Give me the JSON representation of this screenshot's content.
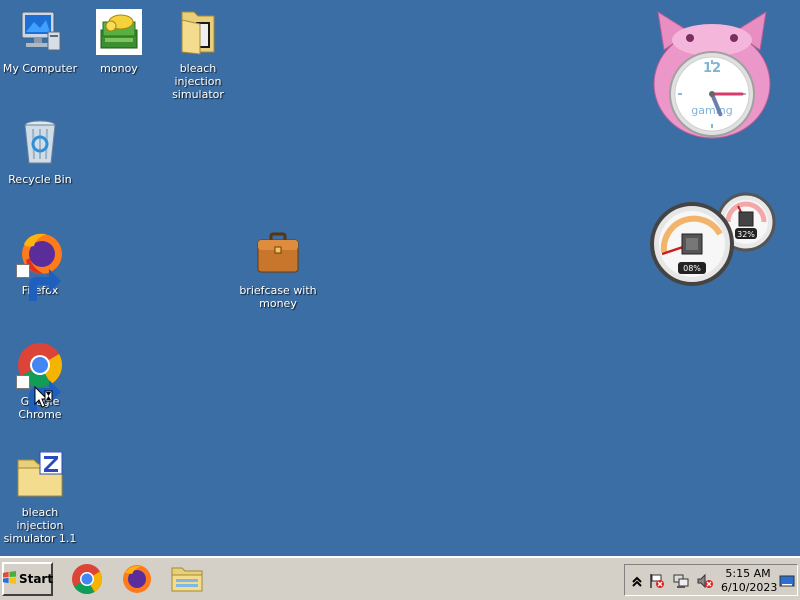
{
  "desktop": {
    "icons": [
      {
        "label": "My Computer",
        "icon": "computer-icon"
      },
      {
        "label": "monoy",
        "icon": "money-icon"
      },
      {
        "label": "bleach injection simulator",
        "icon": "folder-icon"
      },
      {
        "label": "Recycle Bin",
        "icon": "recycle-bin-icon"
      },
      {
        "label": "Firefox",
        "icon": "firefox-icon"
      },
      {
        "label": "briefcase with money",
        "icon": "briefcase-icon"
      },
      {
        "label": "Google Chrome",
        "icon": "chrome-icon"
      },
      {
        "label": "bleach injection simulator 1.1",
        "icon": "zip-folder-icon"
      }
    ]
  },
  "gadgets": {
    "clock": {
      "label": "gaming",
      "twelve": "12",
      "hour": 5,
      "minute": 15
    },
    "cpu_meter": {
      "cpu": "08%",
      "memory": "32%"
    }
  },
  "taskbar": {
    "start_label": "Start",
    "pinned": [
      "chrome-icon",
      "firefox-icon",
      "file-explorer-icon"
    ],
    "tray": {
      "time": "5:15 AM",
      "date": "6/10/2023",
      "icons": [
        "show-hidden-icons",
        "action-center-flag-icon",
        "network-icon",
        "volume-muted-icon",
        "show-desktop-icon"
      ]
    }
  },
  "colors": {
    "desktop_bg": "#3a6ea5",
    "taskbar_bg": "#d4d0c8"
  }
}
